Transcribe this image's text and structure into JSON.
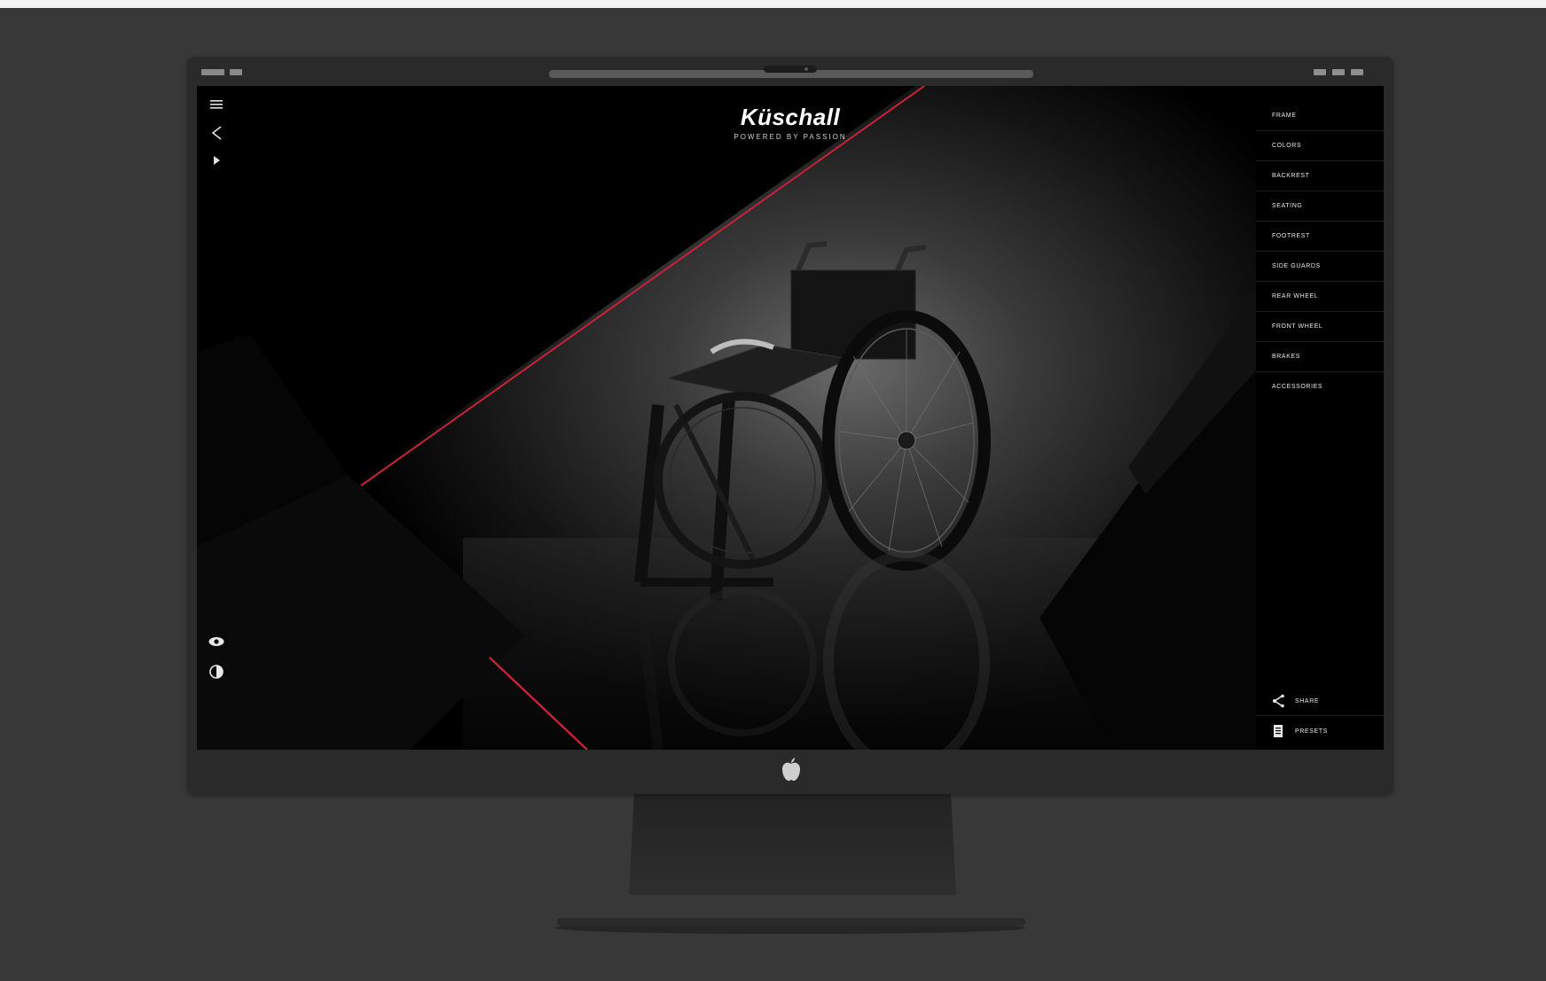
{
  "browser": {
    "status_icons": [
      "clock-indicator",
      "battery-indicator"
    ],
    "window_controls": [
      "minimize-icon",
      "maximize-icon",
      "close-icon"
    ]
  },
  "brand": {
    "logo": "Küschall",
    "tagline": "POWERED BY PASSION"
  },
  "left_toolbar": [
    "menu-icon",
    "back-icon",
    "play-icon",
    "eye-icon",
    "contrast-icon"
  ],
  "right_menu": {
    "items": [
      {
        "label": "FRAME"
      },
      {
        "label": "COLORS"
      },
      {
        "label": "BACKREST"
      },
      {
        "label": "SEATING"
      },
      {
        "label": "FOOTREST"
      },
      {
        "label": "SIDE GUARDS"
      },
      {
        "label": "REAR WHEEL"
      },
      {
        "label": "FRONT WHEEL"
      },
      {
        "label": "BRAKES"
      },
      {
        "label": "ACCESSORIES"
      }
    ],
    "share_label": "SHARE",
    "presets_label": "PRESETS"
  },
  "colors": {
    "accent": "#c8223a",
    "background": "#383838",
    "screen": "#000000"
  }
}
